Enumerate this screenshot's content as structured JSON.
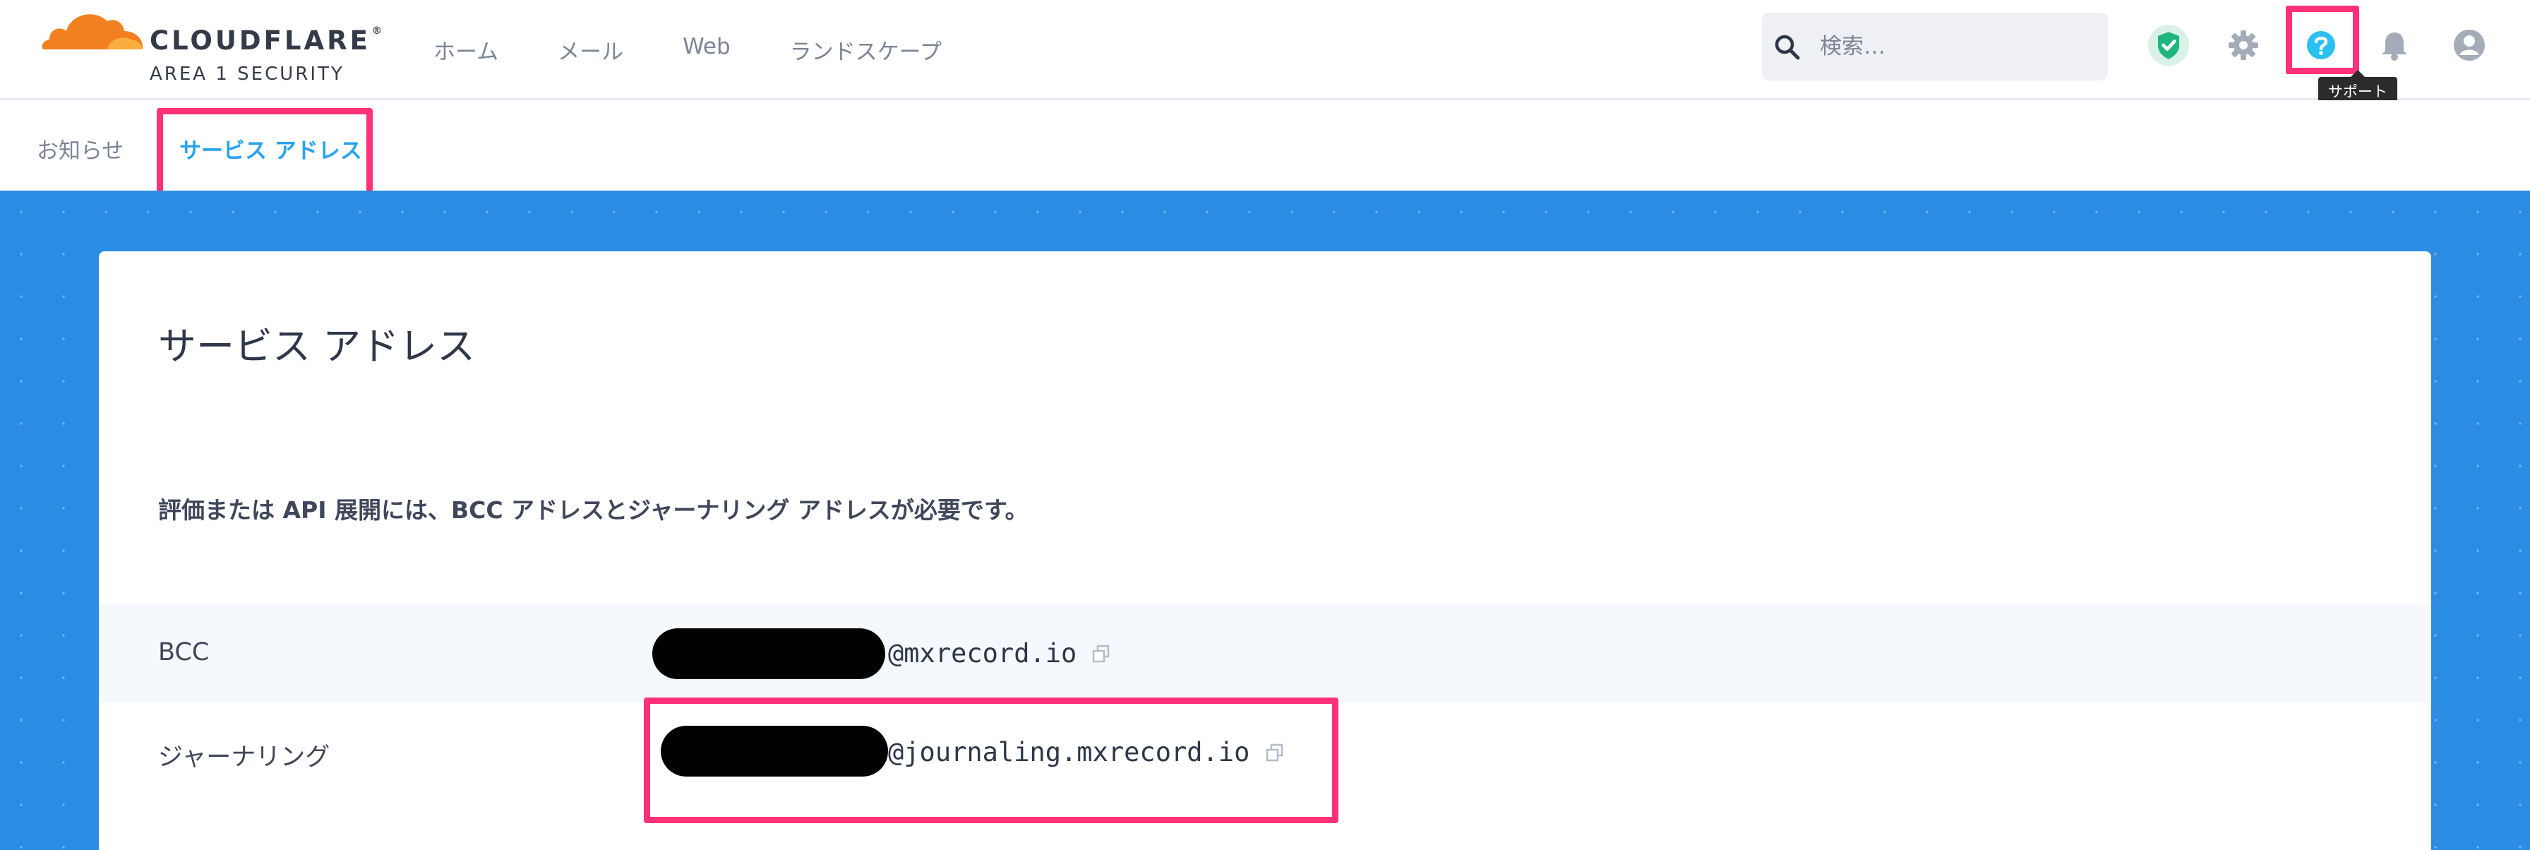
{
  "brand": {
    "name": "CLOUDFLARE",
    "trademark": "®",
    "product": "AREA 1 SECURITY"
  },
  "nav": {
    "items": [
      {
        "label": "ホーム"
      },
      {
        "label": "メール"
      },
      {
        "label": "Web"
      },
      {
        "label": "ランドスケープ"
      }
    ]
  },
  "search": {
    "placeholder": "検索…"
  },
  "header_icons": [
    {
      "icon": "shield-check-icon",
      "color": "#1fb57f"
    },
    {
      "icon": "gear-icon",
      "color": "#a4acb9"
    },
    {
      "icon": "help-icon",
      "color": "#2ac0f0"
    },
    {
      "icon": "bell-icon",
      "color": "#a4acb9"
    },
    {
      "icon": "user-icon",
      "color": "#a4acb9"
    }
  ],
  "tooltip": {
    "text": "サポート"
  },
  "subnav": {
    "tabs": [
      {
        "label": "お知らせ",
        "active": false
      },
      {
        "label": "サービス アドレス",
        "active": true
      }
    ]
  },
  "page": {
    "title": "サービス アドレス",
    "description": "評価または API 展開には、BCC アドレスとジャーナリング アドレスが必要です。"
  },
  "addresses": [
    {
      "label": "BCC",
      "domain": "@mxrecord.io"
    },
    {
      "label": "ジャーナリング",
      "domain": "@journaling.mxrecord.io"
    }
  ],
  "colors": {
    "accent": "#2aa3ef",
    "highlight": "#ff3179",
    "background_blue": "#2b8ce4",
    "brand_orange": "#f38020"
  }
}
